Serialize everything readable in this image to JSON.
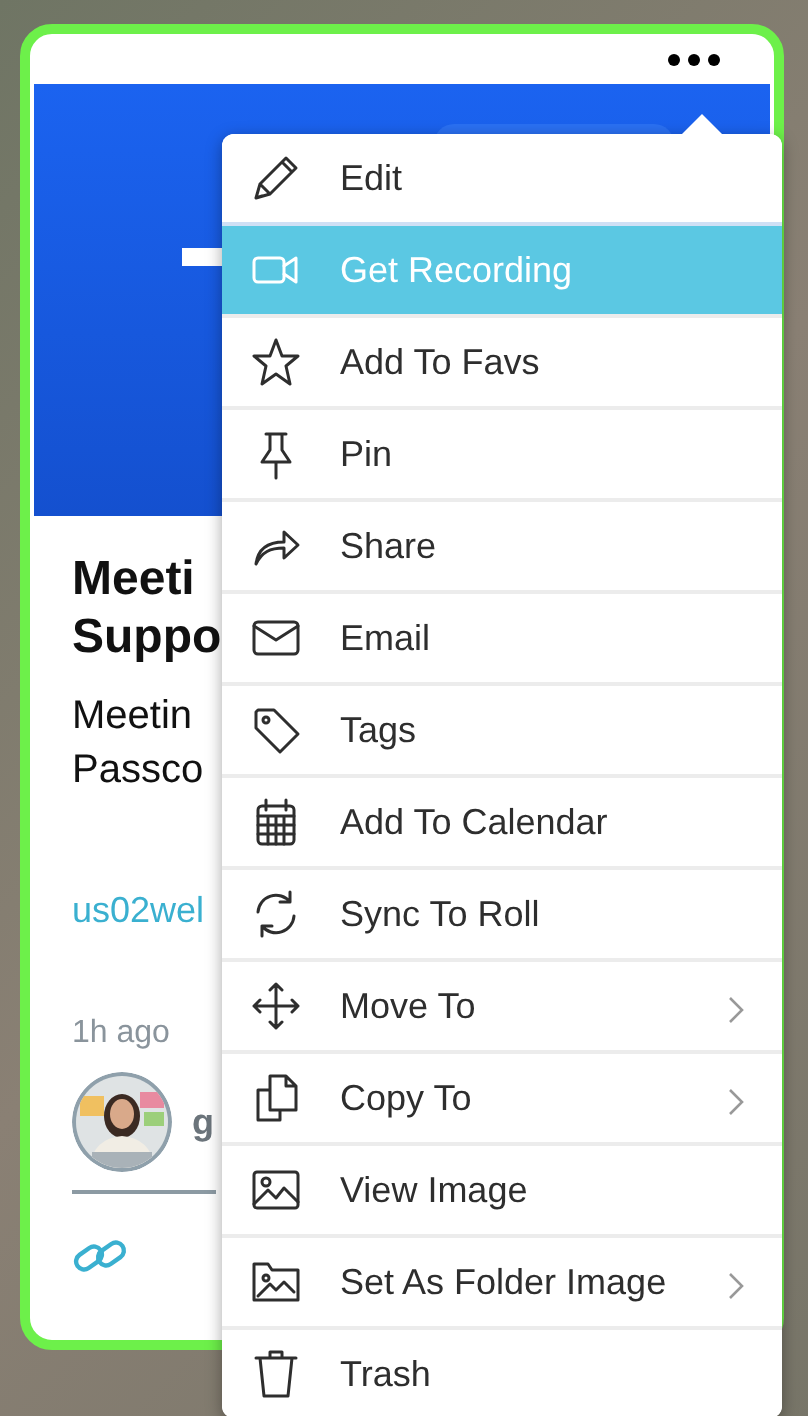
{
  "card": {
    "title_lines": [
      "Meeti",
      "Suppo"
    ],
    "description_lines": [
      "Meetin",
      "Passco"
    ],
    "link": "us02wel",
    "time": "1h ago",
    "author": "g"
  },
  "menu": {
    "items": [
      {
        "label": "Edit",
        "selected": false,
        "submenu": false
      },
      {
        "label": "Get Recording",
        "selected": true,
        "submenu": false
      },
      {
        "label": "Add To Favs",
        "selected": false,
        "submenu": false
      },
      {
        "label": "Pin",
        "selected": false,
        "submenu": false
      },
      {
        "label": "Share",
        "selected": false,
        "submenu": false
      },
      {
        "label": "Email",
        "selected": false,
        "submenu": false
      },
      {
        "label": "Tags",
        "selected": false,
        "submenu": false
      },
      {
        "label": "Add To Calendar",
        "selected": false,
        "submenu": false
      },
      {
        "label": "Sync To Roll",
        "selected": false,
        "submenu": false
      },
      {
        "label": "Move To",
        "selected": false,
        "submenu": true
      },
      {
        "label": "Copy To",
        "selected": false,
        "submenu": true
      },
      {
        "label": "View Image",
        "selected": false,
        "submenu": false
      },
      {
        "label": "Set As Folder Image",
        "selected": false,
        "submenu": true
      },
      {
        "label": "Trash",
        "selected": false,
        "submenu": false
      }
    ]
  }
}
